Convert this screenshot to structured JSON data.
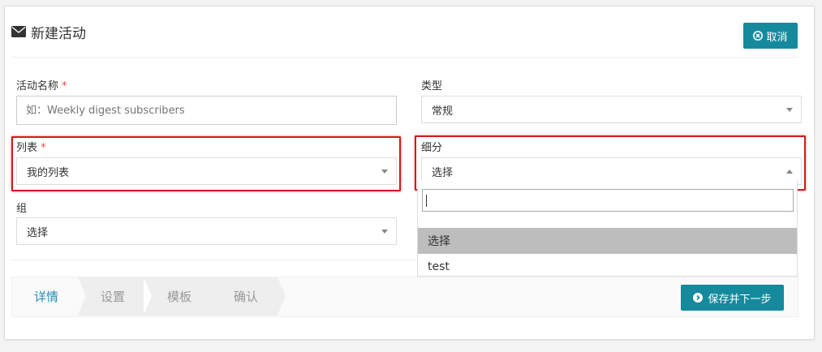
{
  "header": {
    "title": "新建活动",
    "icon": "envelope-icon",
    "cancel_label": "取消"
  },
  "form": {
    "name": {
      "label": "活动名称",
      "required_mark": "*",
      "placeholder": "如：Weekly digest subscribers"
    },
    "type": {
      "label": "类型",
      "value": "常规"
    },
    "list": {
      "label": "列表",
      "required_mark": "*",
      "value": "我的列表"
    },
    "segment": {
      "label": "细分",
      "value": "选择"
    },
    "group": {
      "label": "组",
      "value": "选择"
    }
  },
  "segment_dropdown": {
    "search_value": "",
    "options": [
      {
        "label": "选择",
        "selected": true
      },
      {
        "label": "test",
        "selected": false
      }
    ]
  },
  "steps": [
    {
      "label": "详情",
      "active": true
    },
    {
      "label": "设置",
      "active": false
    },
    {
      "label": "模板",
      "active": false
    },
    {
      "label": "确认",
      "active": false
    }
  ],
  "save_label": "保存并下一步",
  "colors": {
    "primary": "#158a9c",
    "highlight": "#d11b1b",
    "step_active": "#2a8ab0",
    "required": "#d9534f"
  }
}
